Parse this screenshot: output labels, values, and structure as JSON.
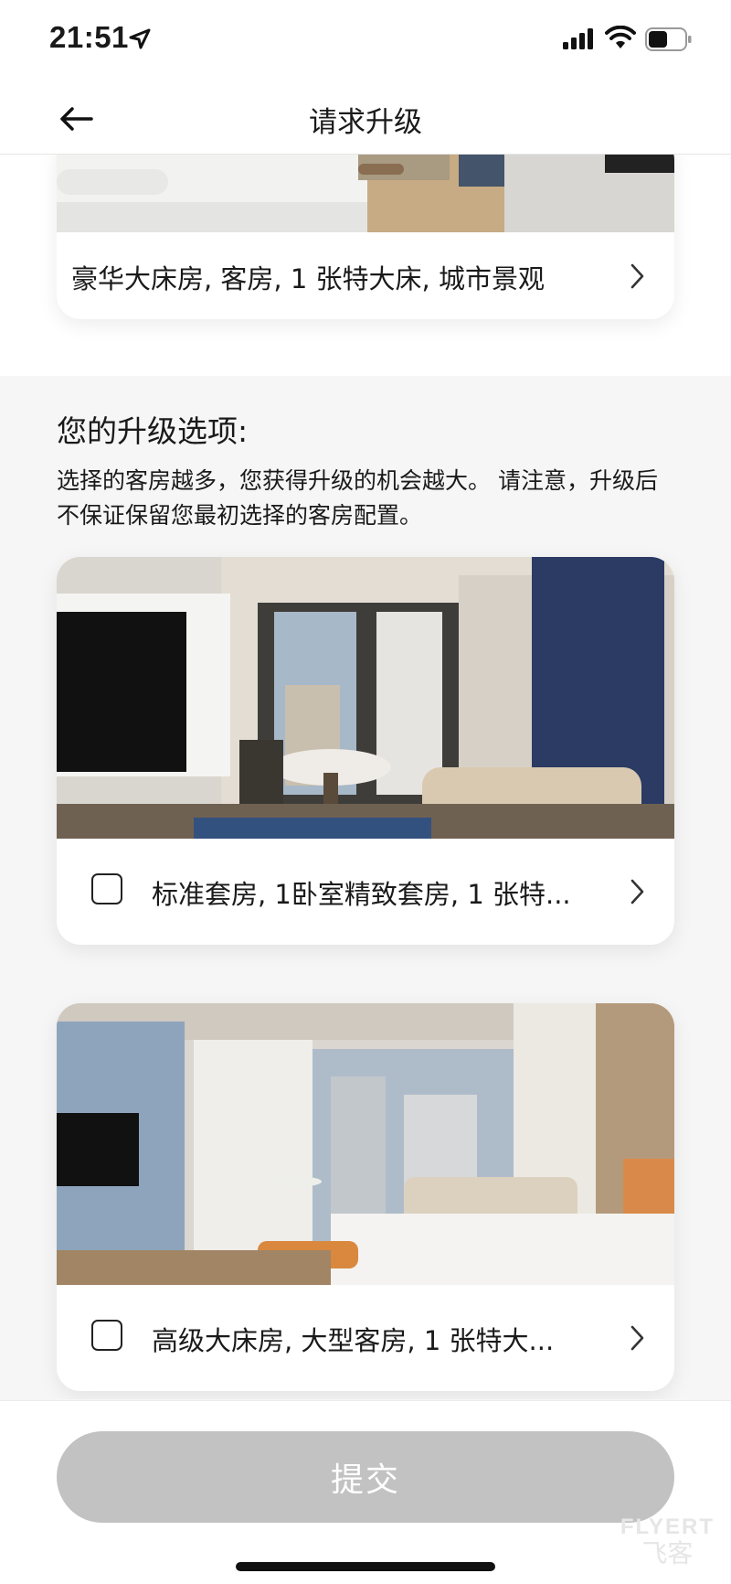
{
  "status_bar": {
    "time": "21:51",
    "icons": [
      "location-arrow-icon",
      "cellular-signal-icon",
      "wifi-icon",
      "battery-icon"
    ]
  },
  "header": {
    "title": "请求升级",
    "back_icon": "arrow-left-icon"
  },
  "current_room": {
    "name": "豪华大床房, 客房, 1 张特大床, 城市景观"
  },
  "upgrade_section": {
    "heading": "您的升级选项:",
    "note": "选择的客房越多，您获得升级的机会越大。 请注意，升级后不保证保留您最初选择的客房配置。"
  },
  "upgrade_options": [
    {
      "name": "标准套房, 1卧室精致套房, 1 张特...",
      "checked": false
    },
    {
      "name": "高级大床房, 大型客房, 1 张特大...",
      "checked": false
    }
  ],
  "footer": {
    "submit_label": "提交",
    "watermark_brand": "FLYERT",
    "watermark_sub": "飞客"
  },
  "colors": {
    "submit_disabled": "#c2c2c2",
    "page_bg": "#f6f6f6",
    "card_bg": "#ffffff",
    "text": "#1a1a1a"
  }
}
